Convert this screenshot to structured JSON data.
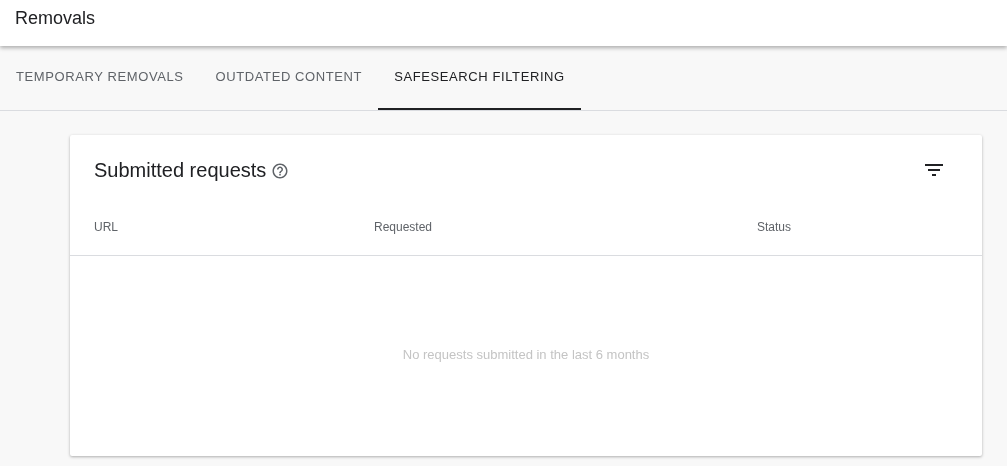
{
  "page_title": "Removals",
  "tabs": [
    {
      "label": "TEMPORARY REMOVALS",
      "selected": false
    },
    {
      "label": "OUTDATED CONTENT",
      "selected": false
    },
    {
      "label": "SAFESEARCH FILTERING",
      "selected": true
    }
  ],
  "card": {
    "title": "Submitted requests",
    "table": {
      "columns": [
        "URL",
        "Requested",
        "Status"
      ],
      "empty_message": "No requests submitted in the last 6 months"
    }
  }
}
